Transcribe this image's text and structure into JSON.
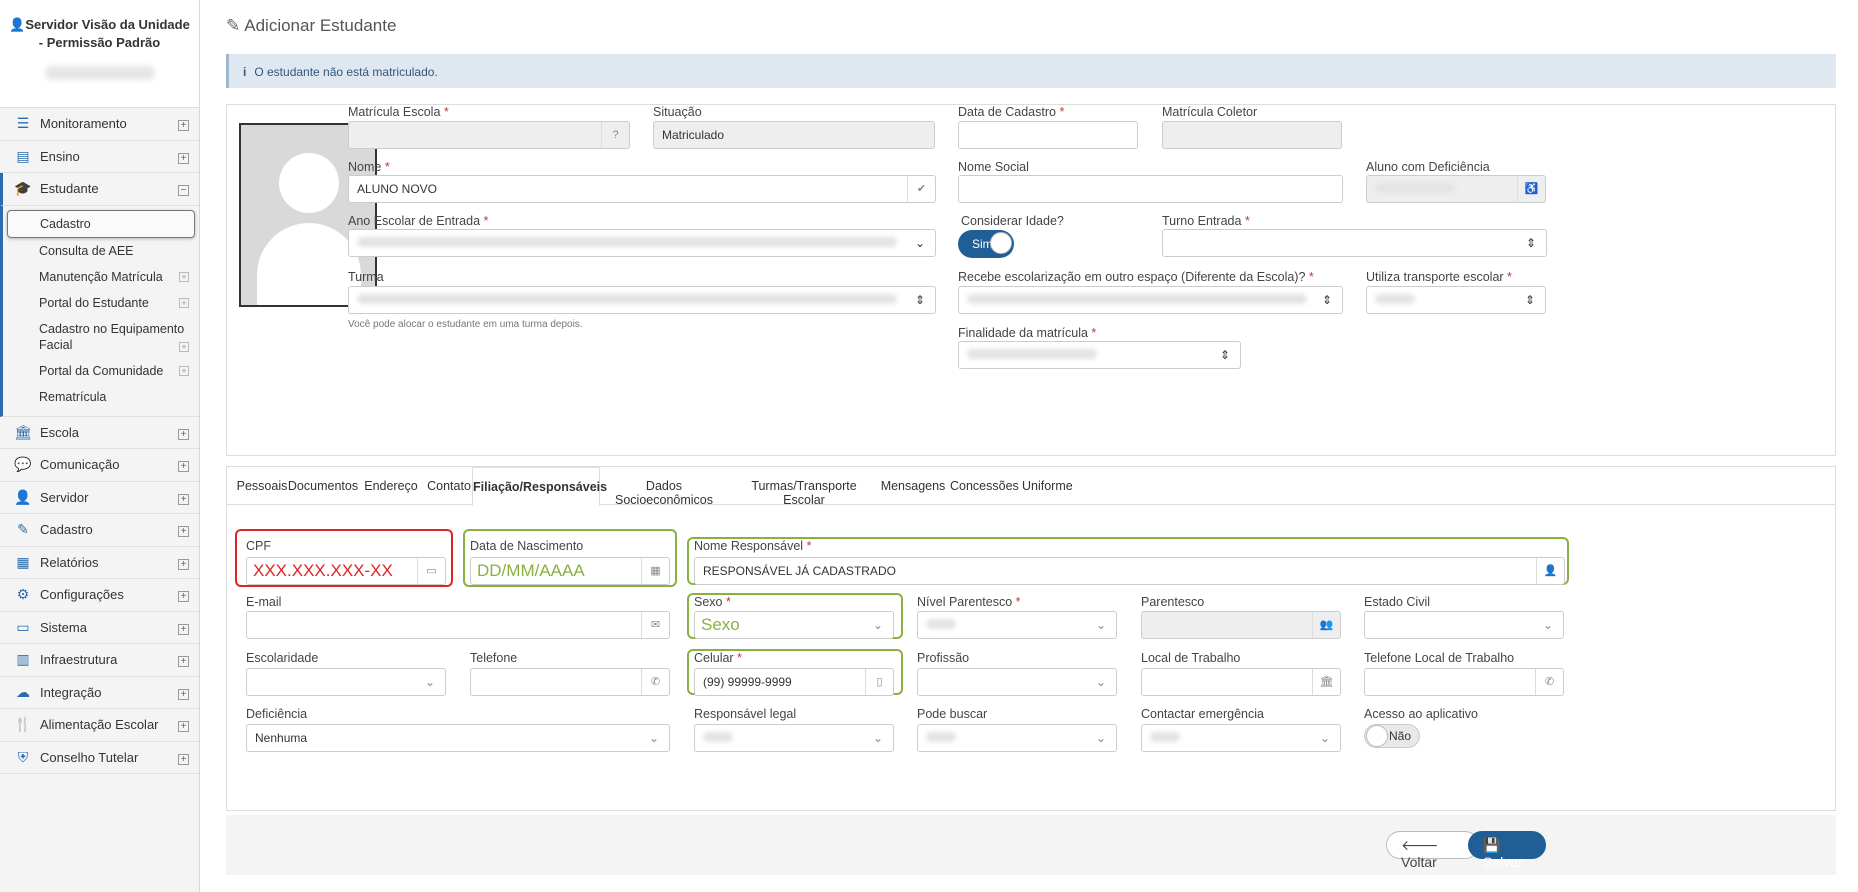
{
  "sidebar": {
    "user_title": "Servidor Visão da Unidade - Permissão Padrão",
    "items": [
      {
        "label": "Monitoramento",
        "icon": "sliders-icon",
        "glyph": "☰",
        "toggle": "⊞"
      },
      {
        "label": "Ensino",
        "icon": "book-icon",
        "glyph": "▤",
        "toggle": "⊞"
      },
      {
        "label": "Estudante",
        "icon": "graduation-cap-icon",
        "glyph": "🎓",
        "toggle": "⊟"
      },
      {
        "label": "Escola",
        "icon": "institution-icon",
        "glyph": "🏛",
        "toggle": "⊞"
      },
      {
        "label": "Comunicação",
        "icon": "chat-icon",
        "glyph": "💬",
        "toggle": "⊞"
      },
      {
        "label": "Servidor",
        "icon": "user-icon",
        "glyph": "👤",
        "toggle": "⊞"
      },
      {
        "label": "Cadastro",
        "icon": "edit-icon",
        "glyph": "✎",
        "toggle": "⊞"
      },
      {
        "label": "Relatórios",
        "icon": "report-icon",
        "glyph": "▦",
        "toggle": "⊞"
      },
      {
        "label": "Configurações",
        "icon": "gear-icon",
        "glyph": "⚙",
        "toggle": "⊞"
      },
      {
        "label": "Sistema",
        "icon": "monitor-icon",
        "glyph": "▭",
        "toggle": "⊞"
      },
      {
        "label": "Infraestrutura",
        "icon": "building-icon",
        "glyph": "▥",
        "toggle": "⊞"
      },
      {
        "label": "Integração",
        "icon": "cloud-icon",
        "glyph": "☁",
        "toggle": "⊞"
      },
      {
        "label": "Alimentação Escolar",
        "icon": "utensils-icon",
        "glyph": "🍴",
        "toggle": "⊞"
      },
      {
        "label": "Conselho Tutelar",
        "icon": "shield-icon",
        "glyph": "⛨",
        "toggle": "⊞"
      }
    ],
    "estudante_sub": [
      {
        "label": "Cadastro"
      },
      {
        "label": "Consulta de AEE"
      },
      {
        "label": "Manutenção Matrícula",
        "toggle": "⊞"
      },
      {
        "label": "Portal do Estudante",
        "toggle": "⊞"
      },
      {
        "label": "Cadastro no Equipamento Facial",
        "toggle": "⊞"
      },
      {
        "label": "Portal da Comunidade",
        "toggle": "⊞"
      },
      {
        "label": "Rematrícula"
      }
    ]
  },
  "page": {
    "title": "Adicionar Estudante",
    "info_message": "O estudante não está matriculado."
  },
  "form": {
    "matricula_escola": {
      "label": "Matrícula Escola",
      "value": ""
    },
    "situacao": {
      "label": "Situação",
      "value": "Matriculado"
    },
    "data_cadastro": {
      "label": "Data de Cadastro",
      "value": ""
    },
    "matricula_coletor": {
      "label": "Matrícula Coletor",
      "value": ""
    },
    "nome": {
      "label": "Nome",
      "value": "ALUNO NOVO"
    },
    "nome_social": {
      "label": "Nome Social",
      "value": ""
    },
    "aluno_deficiencia": {
      "label": "Aluno com Deficiência"
    },
    "ano_escolar": {
      "label": "Ano Escolar de Entrada"
    },
    "considerar_idade": {
      "label": "Considerar Idade?",
      "value": "Sim"
    },
    "turno_entrada": {
      "label": "Turno Entrada"
    },
    "turma": {
      "label": "Turma",
      "help": "Você pode alocar o estudante em uma turma depois."
    },
    "escolarizacao": {
      "label": "Recebe escolarização em outro espaço (Diferente da Escola)?"
    },
    "transporte": {
      "label": "Utiliza transporte escolar"
    },
    "finalidade": {
      "label": "Finalidade da matrícula"
    },
    "required_mark": "*"
  },
  "tabs": [
    {
      "label": "Pessoais"
    },
    {
      "label": "Documentos"
    },
    {
      "label": "Endereço"
    },
    {
      "label": "Contato"
    },
    {
      "label": "Filiação/Responsáveis"
    },
    {
      "label": "Dados Socioeconômicos"
    },
    {
      "label": "Turmas/Transporte Escolar"
    },
    {
      "label": "Mensagens"
    },
    {
      "label": "Concessões"
    },
    {
      "label": "Uniforme"
    }
  ],
  "filiacao": {
    "cpf": {
      "label": "CPF",
      "placeholder": "XXX.XXX.XXX-XX"
    },
    "data_nascimento": {
      "label": "Data de Nascimento",
      "placeholder": "DD/MM/AAAA"
    },
    "nome_responsavel": {
      "label": "Nome Responsável",
      "value": "RESPONSÁVEL JÁ CADASTRADO"
    },
    "email": {
      "label": "E-mail"
    },
    "sexo": {
      "label": "Sexo",
      "placeholder": "Sexo"
    },
    "nivel_parentesco": {
      "label": "Nível Parentesco"
    },
    "parentesco": {
      "label": "Parentesco"
    },
    "estado_civil": {
      "label": "Estado Civil"
    },
    "escolaridade": {
      "label": "Escolaridade"
    },
    "telefone": {
      "label": "Telefone"
    },
    "celular": {
      "label": "Celular",
      "value": "(99) 99999-9999"
    },
    "profissao": {
      "label": "Profissão"
    },
    "local_trabalho": {
      "label": "Local de Trabalho"
    },
    "telefone_local_trabalho": {
      "label": "Telefone Local de Trabalho"
    },
    "deficiencia": {
      "label": "Deficiência",
      "value": "Nenhuma"
    },
    "responsavel_legal": {
      "label": "Responsável legal"
    },
    "pode_buscar": {
      "label": "Pode buscar"
    },
    "contactar_emergencia": {
      "label": "Contactar emergência"
    },
    "acesso_aplicativo": {
      "label": "Acesso ao aplicativo",
      "value": "Não"
    }
  },
  "footer": {
    "back_label": "Voltar",
    "save_label": "Salvar"
  },
  "colors": {
    "primary": "#1f5f96",
    "highlight_red": "#e02424",
    "highlight_green": "#8bb042",
    "info_bg": "#dfe8f1"
  }
}
